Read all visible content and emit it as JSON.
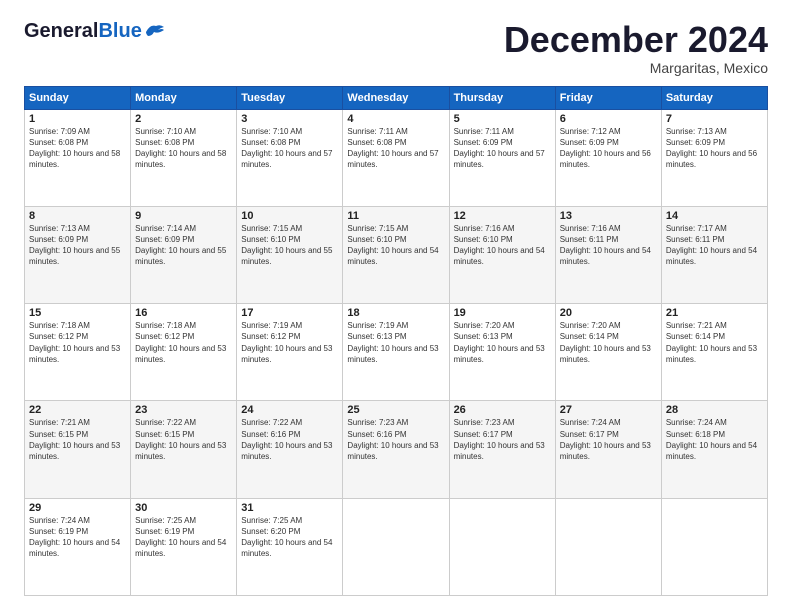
{
  "header": {
    "logo_general": "General",
    "logo_blue": "Blue",
    "month": "December 2024",
    "location": "Margaritas, Mexico"
  },
  "days_of_week": [
    "Sunday",
    "Monday",
    "Tuesday",
    "Wednesday",
    "Thursday",
    "Friday",
    "Saturday"
  ],
  "weeks": [
    [
      {
        "day": "1",
        "sunrise": "7:09 AM",
        "sunset": "6:08 PM",
        "daylight": "10 hours and 58 minutes."
      },
      {
        "day": "2",
        "sunrise": "7:10 AM",
        "sunset": "6:08 PM",
        "daylight": "10 hours and 58 minutes."
      },
      {
        "day": "3",
        "sunrise": "7:10 AM",
        "sunset": "6:08 PM",
        "daylight": "10 hours and 57 minutes."
      },
      {
        "day": "4",
        "sunrise": "7:11 AM",
        "sunset": "6:08 PM",
        "daylight": "10 hours and 57 minutes."
      },
      {
        "day": "5",
        "sunrise": "7:11 AM",
        "sunset": "6:09 PM",
        "daylight": "10 hours and 57 minutes."
      },
      {
        "day": "6",
        "sunrise": "7:12 AM",
        "sunset": "6:09 PM",
        "daylight": "10 hours and 56 minutes."
      },
      {
        "day": "7",
        "sunrise": "7:13 AM",
        "sunset": "6:09 PM",
        "daylight": "10 hours and 56 minutes."
      }
    ],
    [
      {
        "day": "8",
        "sunrise": "7:13 AM",
        "sunset": "6:09 PM",
        "daylight": "10 hours and 55 minutes."
      },
      {
        "day": "9",
        "sunrise": "7:14 AM",
        "sunset": "6:09 PM",
        "daylight": "10 hours and 55 minutes."
      },
      {
        "day": "10",
        "sunrise": "7:15 AM",
        "sunset": "6:10 PM",
        "daylight": "10 hours and 55 minutes."
      },
      {
        "day": "11",
        "sunrise": "7:15 AM",
        "sunset": "6:10 PM",
        "daylight": "10 hours and 54 minutes."
      },
      {
        "day": "12",
        "sunrise": "7:16 AM",
        "sunset": "6:10 PM",
        "daylight": "10 hours and 54 minutes."
      },
      {
        "day": "13",
        "sunrise": "7:16 AM",
        "sunset": "6:11 PM",
        "daylight": "10 hours and 54 minutes."
      },
      {
        "day": "14",
        "sunrise": "7:17 AM",
        "sunset": "6:11 PM",
        "daylight": "10 hours and 54 minutes."
      }
    ],
    [
      {
        "day": "15",
        "sunrise": "7:18 AM",
        "sunset": "6:12 PM",
        "daylight": "10 hours and 53 minutes."
      },
      {
        "day": "16",
        "sunrise": "7:18 AM",
        "sunset": "6:12 PM",
        "daylight": "10 hours and 53 minutes."
      },
      {
        "day": "17",
        "sunrise": "7:19 AM",
        "sunset": "6:12 PM",
        "daylight": "10 hours and 53 minutes."
      },
      {
        "day": "18",
        "sunrise": "7:19 AM",
        "sunset": "6:13 PM",
        "daylight": "10 hours and 53 minutes."
      },
      {
        "day": "19",
        "sunrise": "7:20 AM",
        "sunset": "6:13 PM",
        "daylight": "10 hours and 53 minutes."
      },
      {
        "day": "20",
        "sunrise": "7:20 AM",
        "sunset": "6:14 PM",
        "daylight": "10 hours and 53 minutes."
      },
      {
        "day": "21",
        "sunrise": "7:21 AM",
        "sunset": "6:14 PM",
        "daylight": "10 hours and 53 minutes."
      }
    ],
    [
      {
        "day": "22",
        "sunrise": "7:21 AM",
        "sunset": "6:15 PM",
        "daylight": "10 hours and 53 minutes."
      },
      {
        "day": "23",
        "sunrise": "7:22 AM",
        "sunset": "6:15 PM",
        "daylight": "10 hours and 53 minutes."
      },
      {
        "day": "24",
        "sunrise": "7:22 AM",
        "sunset": "6:16 PM",
        "daylight": "10 hours and 53 minutes."
      },
      {
        "day": "25",
        "sunrise": "7:23 AM",
        "sunset": "6:16 PM",
        "daylight": "10 hours and 53 minutes."
      },
      {
        "day": "26",
        "sunrise": "7:23 AM",
        "sunset": "6:17 PM",
        "daylight": "10 hours and 53 minutes."
      },
      {
        "day": "27",
        "sunrise": "7:24 AM",
        "sunset": "6:17 PM",
        "daylight": "10 hours and 53 minutes."
      },
      {
        "day": "28",
        "sunrise": "7:24 AM",
        "sunset": "6:18 PM",
        "daylight": "10 hours and 54 minutes."
      }
    ],
    [
      {
        "day": "29",
        "sunrise": "7:24 AM",
        "sunset": "6:19 PM",
        "daylight": "10 hours and 54 minutes."
      },
      {
        "day": "30",
        "sunrise": "7:25 AM",
        "sunset": "6:19 PM",
        "daylight": "10 hours and 54 minutes."
      },
      {
        "day": "31",
        "sunrise": "7:25 AM",
        "sunset": "6:20 PM",
        "daylight": "10 hours and 54 minutes."
      },
      null,
      null,
      null,
      null
    ]
  ]
}
